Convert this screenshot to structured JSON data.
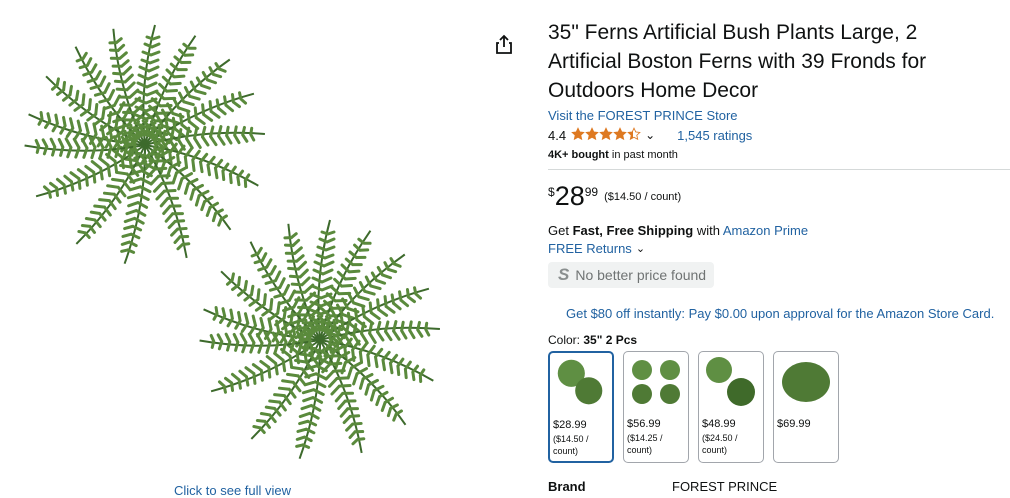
{
  "product": {
    "title": "35\" Ferns Artificial Bush Plants Large, 2 Artificial Boston Ferns with 39 Fronds for Outdoors Home Decor",
    "store_link": "Visit the FOREST PRINCE Store",
    "rating_value": "4.4",
    "rating_stars": 4.4,
    "ratings_count": "1,545 ratings",
    "bought_bold": "4K+ bought",
    "bought_rest": " in past month"
  },
  "price": {
    "symbol": "$",
    "whole": "28",
    "fraction": "99",
    "unit": "($14.50 / count)"
  },
  "shipping": {
    "prefix": "Get ",
    "bold": "Fast, Free Shipping",
    "middle": " with ",
    "link": "Amazon Prime",
    "returns": "FREE Returns"
  },
  "no_better_price": "No better price found",
  "card_offer": "Get $80 off instantly: Pay $0.00 upon approval for the Amazon Store Card.",
  "color": {
    "label": "Color: ",
    "selected": "35\" 2 Pcs",
    "options": [
      {
        "price": "$28.99",
        "unit": "($14.50 / count)"
      },
      {
        "price": "$56.99",
        "unit": "($14.25 / count)"
      },
      {
        "price": "$48.99",
        "unit": "($24.50 / count)"
      },
      {
        "price": "$69.99",
        "unit": ""
      }
    ]
  },
  "brand": {
    "label": "Brand",
    "value": "FOREST PRINCE"
  },
  "image": {
    "click_full_view": "Click to see full view"
  },
  "icons": {
    "share": "share-icon",
    "star": "star-icon",
    "chevron": "chevron-down-icon"
  },
  "colors": {
    "link": "#2162a1",
    "star": "#de7921",
    "fern": "#4f7a35"
  }
}
